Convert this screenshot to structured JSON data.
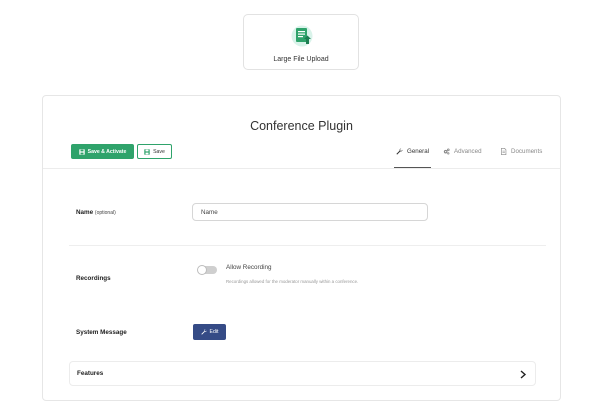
{
  "tile": {
    "label": "Large File Upload",
    "icon": "document-upload-icon"
  },
  "card": {
    "title": "Conference Plugin",
    "buttons": {
      "save_activate": "Save & Activate",
      "save": "Save"
    },
    "tabs": [
      {
        "label": "General",
        "icon": "wrench-icon",
        "active": true
      },
      {
        "label": "Advanced",
        "icon": "gears-icon",
        "active": false
      },
      {
        "label": "Documents",
        "icon": "document-icon",
        "active": false
      }
    ]
  },
  "form": {
    "name": {
      "label": "Name",
      "optional": "(optional)",
      "value": "Name"
    },
    "recordings": {
      "label": "Recordings",
      "toggle_label": "Allow Recording",
      "toggle_on": false,
      "help": "Recordings allowed for the moderator manually within a conference."
    },
    "system_message": {
      "label": "System Message",
      "edit_label": "Edit"
    },
    "features": {
      "label": "Features"
    }
  },
  "colors": {
    "accent_green": "#2fa36b",
    "edit_blue": "#354b86"
  }
}
